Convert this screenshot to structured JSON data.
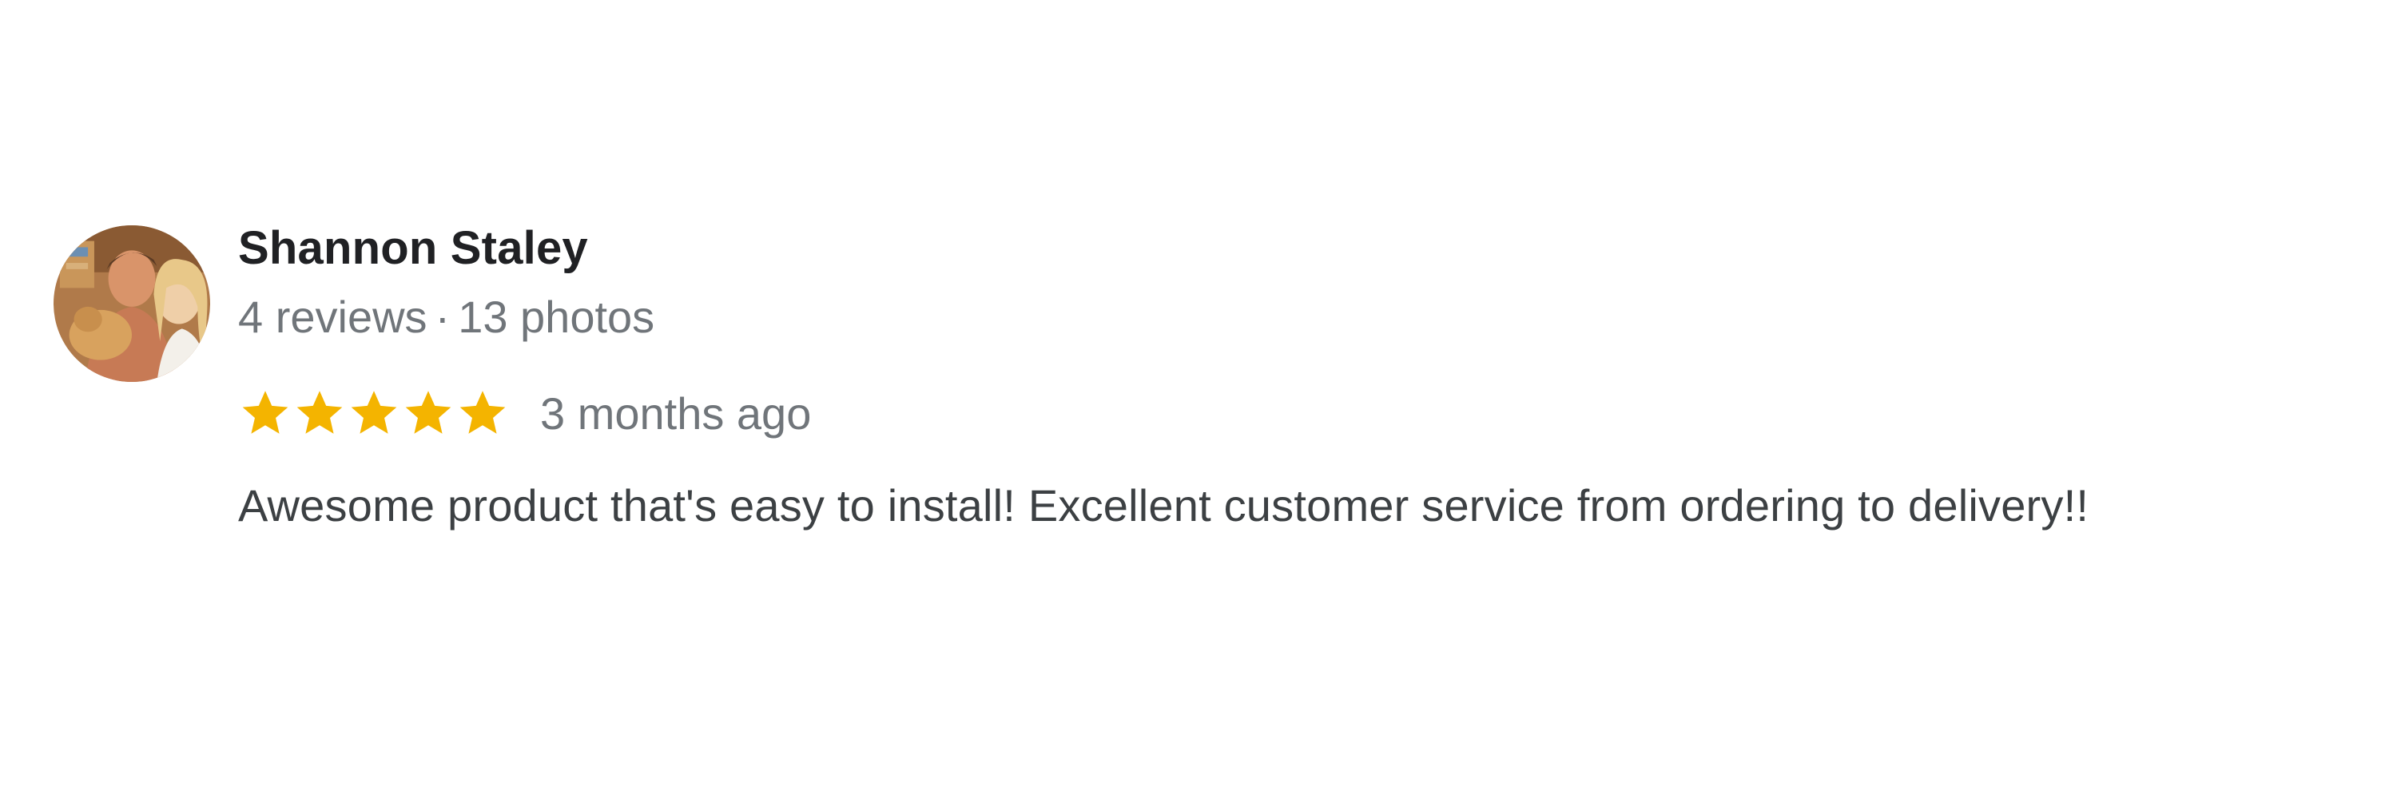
{
  "review": {
    "author": {
      "name": "Shannon Staley",
      "reviews_count": "4 reviews",
      "separator": "·",
      "photos_count": "13 photos",
      "avatar_icon": "user-photo-avatar"
    },
    "rating": {
      "stars": 5,
      "max_stars": 5,
      "star_color": "#f4b400"
    },
    "date": "3 months ago",
    "text": "Awesome product that's easy to install! Excellent customer service from ordering to delivery!!"
  },
  "colors": {
    "name": "#202124",
    "meta": "#70757a",
    "body": "#3c4043",
    "star": "#f4b400"
  }
}
